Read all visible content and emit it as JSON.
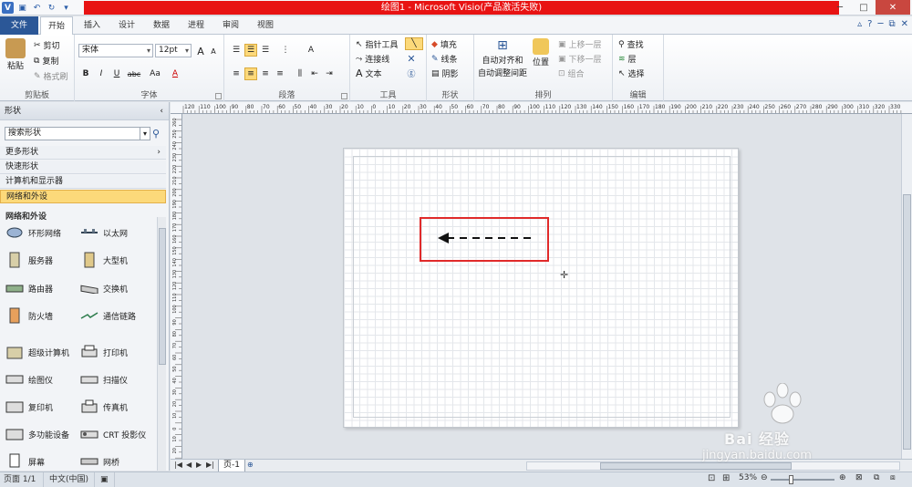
{
  "window": {
    "title": "绘图1  -  Microsoft Visio(产品激活失败)",
    "controls": [
      "─",
      "□",
      "✕"
    ]
  },
  "ribbon_tabs": [
    "文件",
    "开始",
    "插入",
    "设计",
    "数据",
    "进程",
    "审阅",
    "视图"
  ],
  "ribbon": {
    "clipboard": {
      "paste": "粘贴",
      "cut": "剪切",
      "copy": "复制",
      "format_painter": "格式刷",
      "label": "剪贴板"
    },
    "font": {
      "name": "宋体",
      "size": "12pt",
      "bold": "B",
      "italic": "I",
      "underline": "U",
      "strike": "abc",
      "case": "Aa",
      "color": "A",
      "grow": "A",
      "shrink": "A",
      "label": "字体"
    },
    "paragraph": {
      "label": "段落"
    },
    "tools": {
      "pointer": "指针工具",
      "connector": "连接线",
      "text": "文本",
      "label": "工具"
    },
    "shape": {
      "fill": "填充",
      "line": "线条",
      "shadow": "阴影",
      "label": "形状"
    },
    "arrange": {
      "auto_align": "自动对齐和",
      "auto_space": "自动调整间距",
      "position": "位置",
      "bring_forward": "上移一层",
      "send_backward": "下移一层",
      "group": "组合",
      "label": "排列"
    },
    "editing": {
      "find": "查找",
      "layers": "层",
      "select": "选择",
      "label": "编辑"
    }
  },
  "shapes_pane": {
    "title": "形状",
    "search_placeholder": "搜索形状",
    "stencils": [
      "更多形状",
      "快速形状",
      "计算机和显示器",
      "网络和外设"
    ],
    "active_stencil": "网络和外设",
    "stencil_title": "网络和外设",
    "shapes": [
      [
        "环形网络",
        "以太网"
      ],
      [
        "服务器",
        "大型机"
      ],
      [
        "路由器",
        "交换机"
      ],
      [
        "防火墙",
        "通信链路"
      ],
      [
        "超级计算机",
        "打印机"
      ],
      [
        "绘图仪",
        "扫描仪"
      ],
      [
        "复印机",
        "传真机"
      ],
      [
        "多功能设备",
        "CRT 投影仪"
      ],
      [
        "屏幕",
        "网桥"
      ]
    ]
  },
  "ruler_top_labels": [
    "120",
    "110",
    "100",
    "90",
    "80",
    "70",
    "60",
    "50",
    "40",
    "30",
    "20",
    "10",
    "0",
    "10",
    "20",
    "30",
    "40",
    "50",
    "60",
    "70",
    "80",
    "90",
    "100",
    "110",
    "120",
    "130",
    "140",
    "150",
    "160",
    "170",
    "180",
    "190",
    "200",
    "210",
    "220",
    "230",
    "240",
    "250",
    "260",
    "270",
    "280",
    "290",
    "300",
    "310",
    "320",
    "330"
  ],
  "ruler_left_labels": [
    "260",
    "250",
    "240",
    "230",
    "220",
    "210",
    "200",
    "190",
    "180",
    "170",
    "160",
    "150",
    "140",
    "130",
    "120",
    "110",
    "100",
    "90",
    "80",
    "70",
    "60",
    "50",
    "40",
    "30",
    "20",
    "10",
    "0",
    "10",
    "20",
    "30"
  ],
  "page_tab": "页-1",
  "status": {
    "page": "页面 1/1",
    "language": "中文(中国)",
    "zoom": "53%"
  },
  "watermark": {
    "brand": "Bai   经验",
    "url": "jingyan.baidu.com"
  }
}
